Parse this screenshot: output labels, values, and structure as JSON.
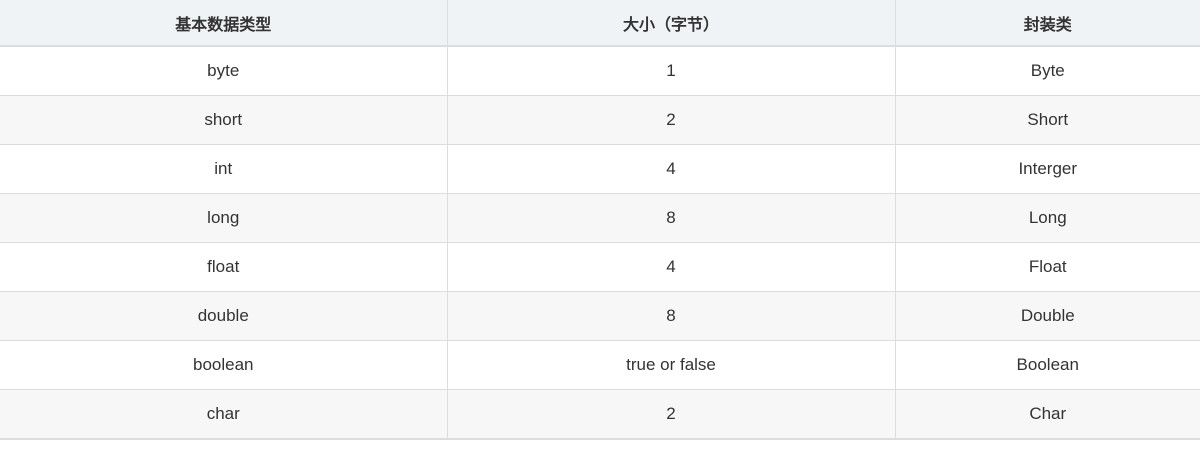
{
  "table": {
    "headers": [
      "基本数据类型",
      "大小（字节）",
      "封装类"
    ],
    "rows": [
      [
        "byte",
        "1",
        "Byte"
      ],
      [
        "short",
        "2",
        "Short"
      ],
      [
        "int",
        "4",
        "Interger"
      ],
      [
        "long",
        "8",
        "Long"
      ],
      [
        "float",
        "4",
        "Float"
      ],
      [
        "double",
        "8",
        "Double"
      ],
      [
        "boolean",
        "true or false",
        "Boolean"
      ],
      [
        "char",
        "2",
        "Char"
      ]
    ]
  }
}
